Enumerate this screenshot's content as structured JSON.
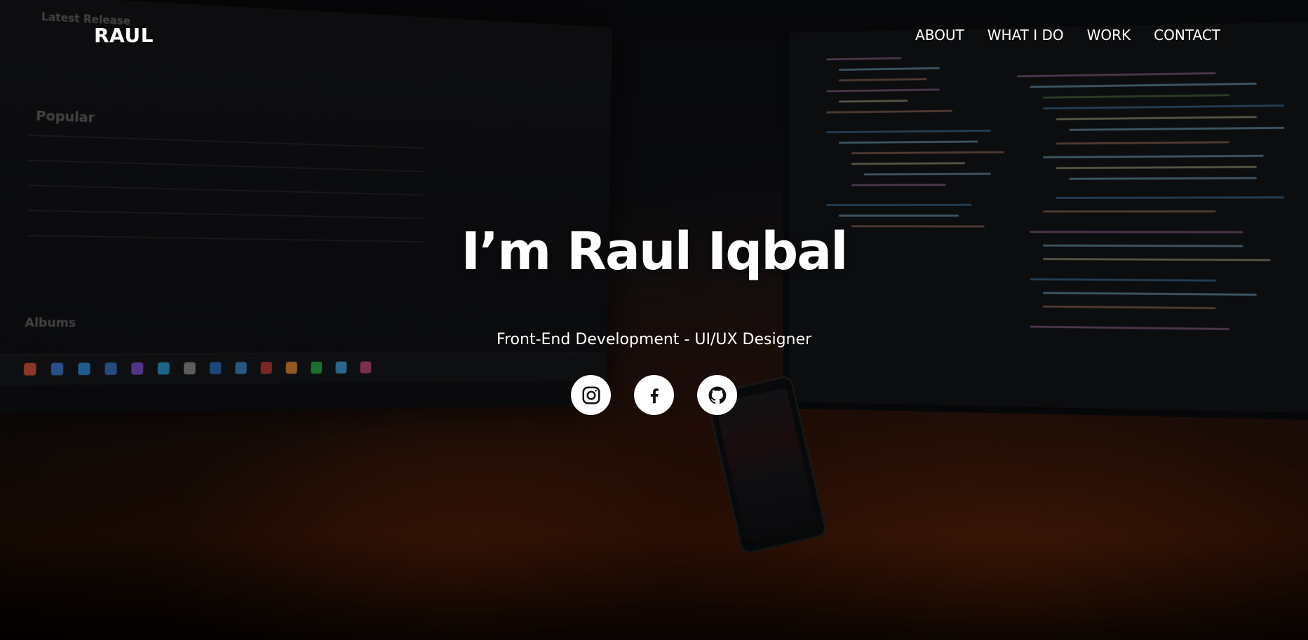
{
  "navbar": {
    "brand": "RAUL",
    "links": [
      {
        "label": "ABOUT"
      },
      {
        "label": "WHAT I DO"
      },
      {
        "label": "WORK"
      },
      {
        "label": "CONTACT"
      }
    ]
  },
  "hero": {
    "title": "I’m Raul Iqbal",
    "subtitle": "Front-End Development - UI/UX Designer",
    "socials": [
      {
        "icon": "instagram-icon"
      },
      {
        "icon": "facebook-icon"
      },
      {
        "icon": "github-icon"
      }
    ]
  },
  "colors": {
    "text": "#ffffff",
    "icon_background": "#ffffff",
    "icon_foreground": "#111111"
  }
}
